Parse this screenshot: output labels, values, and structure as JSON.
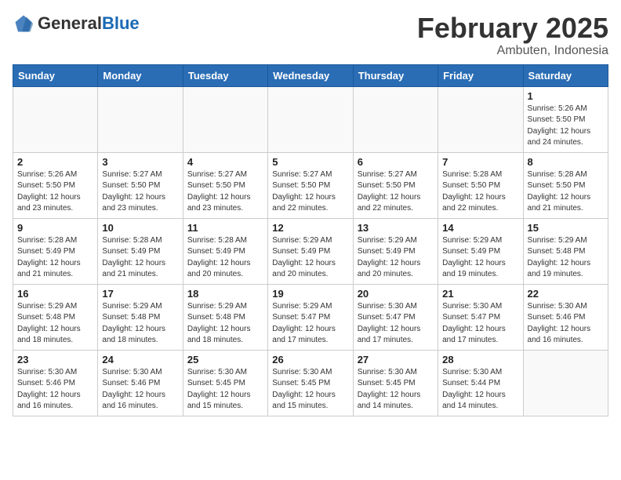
{
  "header": {
    "logo_general": "General",
    "logo_blue": "Blue",
    "month_title": "February 2025",
    "location": "Ambuten, Indonesia"
  },
  "days_of_week": [
    "Sunday",
    "Monday",
    "Tuesday",
    "Wednesday",
    "Thursday",
    "Friday",
    "Saturday"
  ],
  "weeks": [
    [
      {
        "day": "",
        "info": ""
      },
      {
        "day": "",
        "info": ""
      },
      {
        "day": "",
        "info": ""
      },
      {
        "day": "",
        "info": ""
      },
      {
        "day": "",
        "info": ""
      },
      {
        "day": "",
        "info": ""
      },
      {
        "day": "1",
        "info": "Sunrise: 5:26 AM\nSunset: 5:50 PM\nDaylight: 12 hours\nand 24 minutes."
      }
    ],
    [
      {
        "day": "2",
        "info": "Sunrise: 5:26 AM\nSunset: 5:50 PM\nDaylight: 12 hours\nand 23 minutes."
      },
      {
        "day": "3",
        "info": "Sunrise: 5:27 AM\nSunset: 5:50 PM\nDaylight: 12 hours\nand 23 minutes."
      },
      {
        "day": "4",
        "info": "Sunrise: 5:27 AM\nSunset: 5:50 PM\nDaylight: 12 hours\nand 23 minutes."
      },
      {
        "day": "5",
        "info": "Sunrise: 5:27 AM\nSunset: 5:50 PM\nDaylight: 12 hours\nand 22 minutes."
      },
      {
        "day": "6",
        "info": "Sunrise: 5:27 AM\nSunset: 5:50 PM\nDaylight: 12 hours\nand 22 minutes."
      },
      {
        "day": "7",
        "info": "Sunrise: 5:28 AM\nSunset: 5:50 PM\nDaylight: 12 hours\nand 22 minutes."
      },
      {
        "day": "8",
        "info": "Sunrise: 5:28 AM\nSunset: 5:50 PM\nDaylight: 12 hours\nand 21 minutes."
      }
    ],
    [
      {
        "day": "9",
        "info": "Sunrise: 5:28 AM\nSunset: 5:49 PM\nDaylight: 12 hours\nand 21 minutes."
      },
      {
        "day": "10",
        "info": "Sunrise: 5:28 AM\nSunset: 5:49 PM\nDaylight: 12 hours\nand 21 minutes."
      },
      {
        "day": "11",
        "info": "Sunrise: 5:28 AM\nSunset: 5:49 PM\nDaylight: 12 hours\nand 20 minutes."
      },
      {
        "day": "12",
        "info": "Sunrise: 5:29 AM\nSunset: 5:49 PM\nDaylight: 12 hours\nand 20 minutes."
      },
      {
        "day": "13",
        "info": "Sunrise: 5:29 AM\nSunset: 5:49 PM\nDaylight: 12 hours\nand 20 minutes."
      },
      {
        "day": "14",
        "info": "Sunrise: 5:29 AM\nSunset: 5:49 PM\nDaylight: 12 hours\nand 19 minutes."
      },
      {
        "day": "15",
        "info": "Sunrise: 5:29 AM\nSunset: 5:48 PM\nDaylight: 12 hours\nand 19 minutes."
      }
    ],
    [
      {
        "day": "16",
        "info": "Sunrise: 5:29 AM\nSunset: 5:48 PM\nDaylight: 12 hours\nand 18 minutes."
      },
      {
        "day": "17",
        "info": "Sunrise: 5:29 AM\nSunset: 5:48 PM\nDaylight: 12 hours\nand 18 minutes."
      },
      {
        "day": "18",
        "info": "Sunrise: 5:29 AM\nSunset: 5:48 PM\nDaylight: 12 hours\nand 18 minutes."
      },
      {
        "day": "19",
        "info": "Sunrise: 5:29 AM\nSunset: 5:47 PM\nDaylight: 12 hours\nand 17 minutes."
      },
      {
        "day": "20",
        "info": "Sunrise: 5:30 AM\nSunset: 5:47 PM\nDaylight: 12 hours\nand 17 minutes."
      },
      {
        "day": "21",
        "info": "Sunrise: 5:30 AM\nSunset: 5:47 PM\nDaylight: 12 hours\nand 17 minutes."
      },
      {
        "day": "22",
        "info": "Sunrise: 5:30 AM\nSunset: 5:46 PM\nDaylight: 12 hours\nand 16 minutes."
      }
    ],
    [
      {
        "day": "23",
        "info": "Sunrise: 5:30 AM\nSunset: 5:46 PM\nDaylight: 12 hours\nand 16 minutes."
      },
      {
        "day": "24",
        "info": "Sunrise: 5:30 AM\nSunset: 5:46 PM\nDaylight: 12 hours\nand 16 minutes."
      },
      {
        "day": "25",
        "info": "Sunrise: 5:30 AM\nSunset: 5:45 PM\nDaylight: 12 hours\nand 15 minutes."
      },
      {
        "day": "26",
        "info": "Sunrise: 5:30 AM\nSunset: 5:45 PM\nDaylight: 12 hours\nand 15 minutes."
      },
      {
        "day": "27",
        "info": "Sunrise: 5:30 AM\nSunset: 5:45 PM\nDaylight: 12 hours\nand 14 minutes."
      },
      {
        "day": "28",
        "info": "Sunrise: 5:30 AM\nSunset: 5:44 PM\nDaylight: 12 hours\nand 14 minutes."
      },
      {
        "day": "",
        "info": ""
      }
    ]
  ]
}
